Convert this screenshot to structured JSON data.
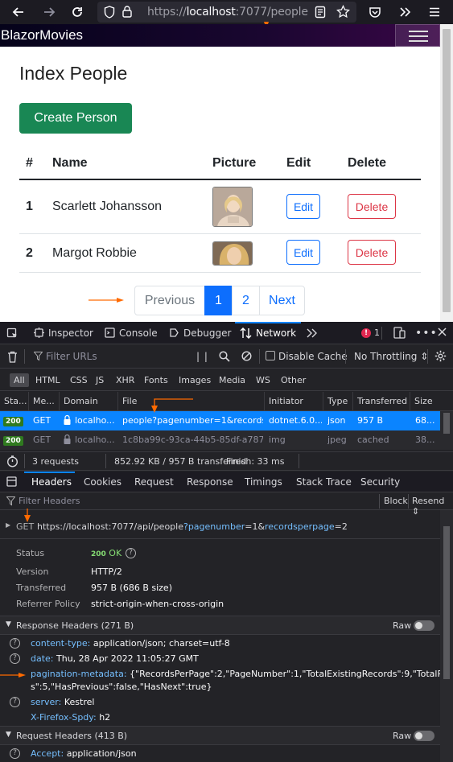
{
  "browser": {
    "url_prefix": "https://",
    "url_host": "localhost",
    "url_rest": ":7077/people",
    "icons": [
      "back-arrow-icon",
      "forward-arrow-icon",
      "reload-icon",
      "shield-icon",
      "lock-icon",
      "reader-view-icon",
      "bookmark-star-icon",
      "pocket-icon",
      "overflow-chevrons-icon",
      "menu-icon"
    ]
  },
  "app": {
    "brand": "BlazorMovies",
    "page_title": "Index People",
    "create_button": "Create Person",
    "table": {
      "headers": [
        "#",
        "Name",
        "Picture",
        "Edit",
        "Delete"
      ],
      "rows": [
        {
          "num": "1",
          "name": "Scarlett Johansson",
          "edit": "Edit",
          "delete": "Delete"
        },
        {
          "num": "2",
          "name": "Margot Robbie",
          "edit": "Edit",
          "delete": "Delete"
        }
      ]
    },
    "pagination": {
      "previous": "Previous",
      "pages": [
        "1",
        "2"
      ],
      "next": "Next",
      "active_page": "1"
    }
  },
  "devtools": {
    "tabs": [
      "Inspector",
      "Console",
      "Debugger",
      "Network"
    ],
    "selected_tab": "Network",
    "error_count": "1",
    "filter_placeholder": "Filter URLs",
    "disable_cache": "Disable Cache",
    "throttling": "No Throttling",
    "type_filters": [
      "All",
      "HTML",
      "CSS",
      "JS",
      "XHR",
      "Fonts",
      "Images",
      "Media",
      "WS",
      "Other"
    ],
    "columns": [
      "Sta...",
      "Me...",
      "Domain",
      "File",
      "Initiator",
      "Type",
      "Transferred",
      "Size"
    ],
    "requests": [
      {
        "status": "200",
        "method": "GET",
        "domain": "localho...",
        "file": "people?pagenumber=1&recordsp",
        "initiator": "dotnet.6.0...",
        "type": "json",
        "transferred": "957 B",
        "size": "68..."
      },
      {
        "status": "200",
        "method": "GET",
        "domain": "localho...",
        "file": "1c8ba99c-93ca-44b5-85df-a787b1a",
        "initiator": "img",
        "type": "jpeg",
        "transferred": "cached",
        "size": "38..."
      }
    ],
    "summary": {
      "requests": "3 requests",
      "transferred": "852.92 KB / 957 B transferred",
      "finish": "Finish: 33 ms"
    },
    "detail_tabs": [
      "Headers",
      "Cookies",
      "Request",
      "Response",
      "Timings",
      "Stack Trace",
      "Security"
    ],
    "selected_detail_tab": "Headers",
    "filter_headers": "Filter Headers",
    "block": "Block",
    "resend": "Resend",
    "request_line": {
      "method": "GET",
      "url_base": "https://localhost:7077/api/people",
      "q1": "?",
      "p1_name": "pagenumber",
      "p1_val": "=1&",
      "p2_name": "recordsperpage",
      "p2_val": "=2"
    },
    "summary_info": [
      {
        "key": "Status",
        "value": "200 OK"
      },
      {
        "key": "Version",
        "value": "HTTP/2"
      },
      {
        "key": "Transferred",
        "value": "957 B (686 B size)"
      },
      {
        "key": "Referrer Policy",
        "value": "strict-origin-when-cross-origin"
      }
    ],
    "status_code": "200",
    "status_text": "OK",
    "response_headers_title": "Response Headers (271 B)",
    "raw": "Raw",
    "response_headers": [
      {
        "name": "content-type:",
        "value": "application/json; charset=utf-8"
      },
      {
        "name": "date:",
        "value": "Thu, 28 Apr 2022 11:05:27 GMT"
      },
      {
        "name": "pagination-metadata:",
        "value": "{\"RecordsPerPage\":2,\"PageNumber\":1,\"TotalExistingRecords\":9,\"TotalPage",
        "value2": "s\":5,\"HasPrevious\":false,\"HasNext\":true}"
      },
      {
        "name": "server:",
        "value": "Kestrel"
      },
      {
        "name": "X-Firefox-Spdy:",
        "value": "h2"
      }
    ],
    "request_headers_title": "Request Headers (413 B)",
    "request_headers": [
      {
        "name": "Accept:",
        "value": "application/json"
      }
    ]
  },
  "colors": {
    "accent": "#0a84ff",
    "annotation": "#ff6a00",
    "success": "#198754",
    "primary": "#0d6efd",
    "danger": "#dc3545"
  }
}
